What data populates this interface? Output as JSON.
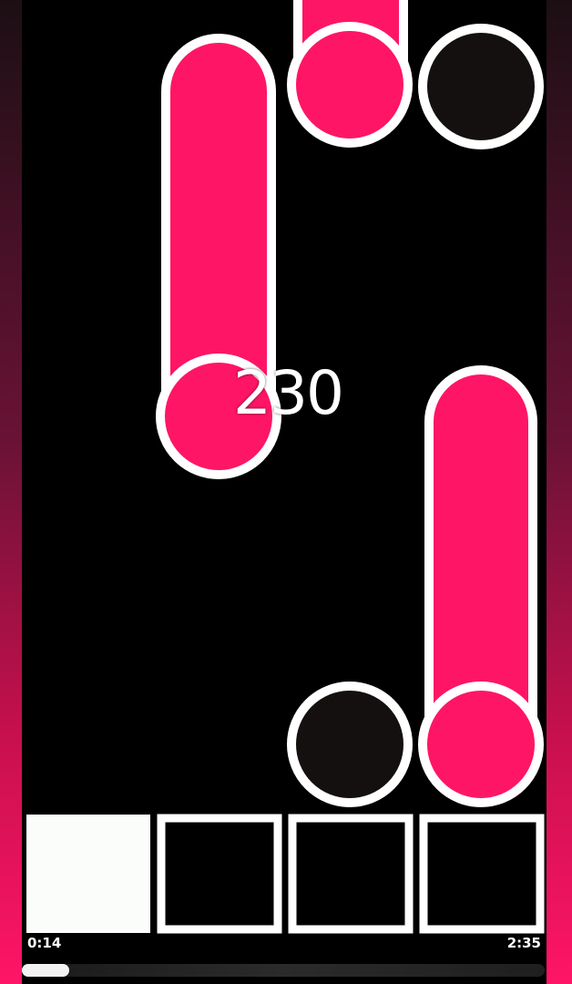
{
  "game": {
    "score": "230",
    "colors": {
      "accent": "#ff1566",
      "tile_outline": "#ffffff",
      "black_note": "#141010",
      "background": "#000000",
      "active_key": "#fbfdfa"
    },
    "notes": [
      {
        "kind": "long",
        "color": "pink",
        "lane": 1
      },
      {
        "kind": "long",
        "color": "pink",
        "lane": 2
      },
      {
        "kind": "tap",
        "color": "black",
        "lane": 3
      },
      {
        "kind": "long",
        "color": "pink",
        "lane": 3
      },
      {
        "kind": "tap",
        "color": "black",
        "lane": 2
      }
    ],
    "keys": [
      {
        "name": "key-1",
        "active": true
      },
      {
        "name": "key-2",
        "active": false
      },
      {
        "name": "key-3",
        "active": false
      },
      {
        "name": "key-4",
        "active": false
      }
    ]
  },
  "player": {
    "elapsed": "0:14",
    "total": "2:35",
    "progress": 0.09
  }
}
